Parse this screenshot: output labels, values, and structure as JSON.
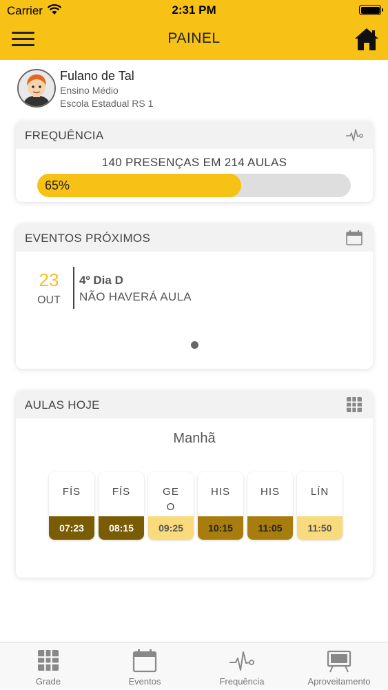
{
  "status_bar": {
    "carrier": "Carrier",
    "time": "2:31 PM"
  },
  "header": {
    "title": "PAINEL",
    "menu_icon": "hamburger-menu-icon",
    "home_icon": "home-icon"
  },
  "profile": {
    "name": "Fulano de Tal",
    "level": "Ensino Médio",
    "school": "Escola Estadual RS 1"
  },
  "frequency": {
    "title": "FREQUÊNCIA",
    "icon": "heartbeat-icon",
    "summary": "140 PRESENÇAS EM 214 AULAS",
    "percent_label": "65%",
    "percent": 65,
    "colors": {
      "fill": "#f7c215",
      "track": "#dedede"
    }
  },
  "events": {
    "title": "EVENTOS PRÓXIMOS",
    "icon": "calendar-icon",
    "items": [
      {
        "day": "23",
        "month": "OUT",
        "title": "4º Dia D",
        "description": "NÃO HAVERÁ AULA"
      }
    ]
  },
  "classes_today": {
    "title": "AULAS HOJE",
    "icon": "grid-icon",
    "shift": "Manhã",
    "classes": [
      {
        "subject_line1": "FÍS",
        "subject_line2": "",
        "time": "07:23",
        "bg": "#7a5c05",
        "fg": "#ffffff"
      },
      {
        "subject_line1": "FÍS",
        "subject_line2": "",
        "time": "08:15",
        "bg": "#7a5c05",
        "fg": "#ffffff"
      },
      {
        "subject_line1": "GE",
        "subject_line2": "O",
        "time": "09:25",
        "bg": "#f9da7c",
        "fg": "#555555"
      },
      {
        "subject_line1": "HIS",
        "subject_line2": "",
        "time": "10:15",
        "bg": "#a87d0e",
        "fg": "#222222"
      },
      {
        "subject_line1": "HIS",
        "subject_line2": "",
        "time": "11:05",
        "bg": "#a87d0e",
        "fg": "#222222"
      },
      {
        "subject_line1": "LÍN",
        "subject_line2": "",
        "time": "11:50",
        "bg": "#f9da7c",
        "fg": "#555555"
      }
    ]
  },
  "tabbar": {
    "items": [
      {
        "label": "Grade",
        "icon": "grid-icon"
      },
      {
        "label": "Eventos",
        "icon": "calendar-icon"
      },
      {
        "label": "Frequência",
        "icon": "heartbeat-icon"
      },
      {
        "label": "Aproveitamento",
        "icon": "presentation-board-icon"
      }
    ]
  },
  "colors": {
    "accent": "#f7c215"
  }
}
